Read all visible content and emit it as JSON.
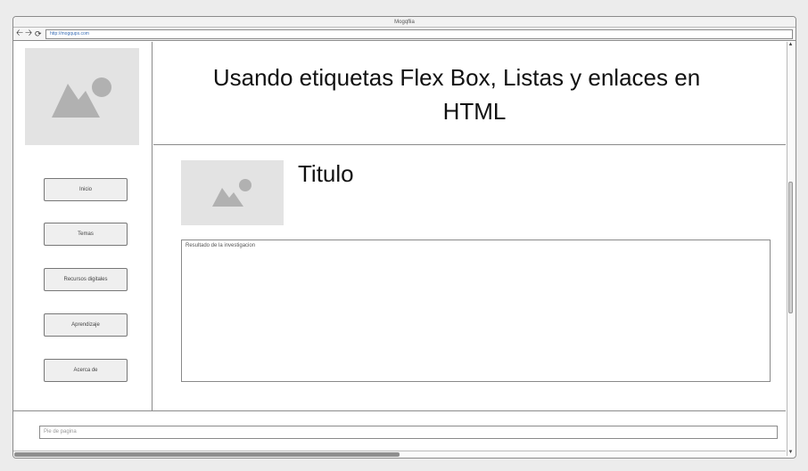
{
  "window": {
    "title": "Mogqflia"
  },
  "navbar": {
    "back_icon": "arrow-left-icon",
    "forward_icon": "arrow-right-icon",
    "reload_icon": "reload-icon",
    "url": "http://mogqups.com"
  },
  "sidebar": {
    "image": "image-placeholder-icon",
    "items": [
      {
        "label": "Inicio"
      },
      {
        "label": "Temas"
      },
      {
        "label": "Recursos digitales"
      },
      {
        "label": "Aprendizaje"
      },
      {
        "label": "Acerca de"
      }
    ]
  },
  "header": {
    "title_line1": "Usando etiquetas Flex Box, Listas y enlaces en",
    "title_line2": "HTML"
  },
  "main": {
    "title": "Titulo",
    "textarea_text": "Resultado de la investigacion"
  },
  "footer": {
    "placeholder": "Pie de pagina"
  }
}
